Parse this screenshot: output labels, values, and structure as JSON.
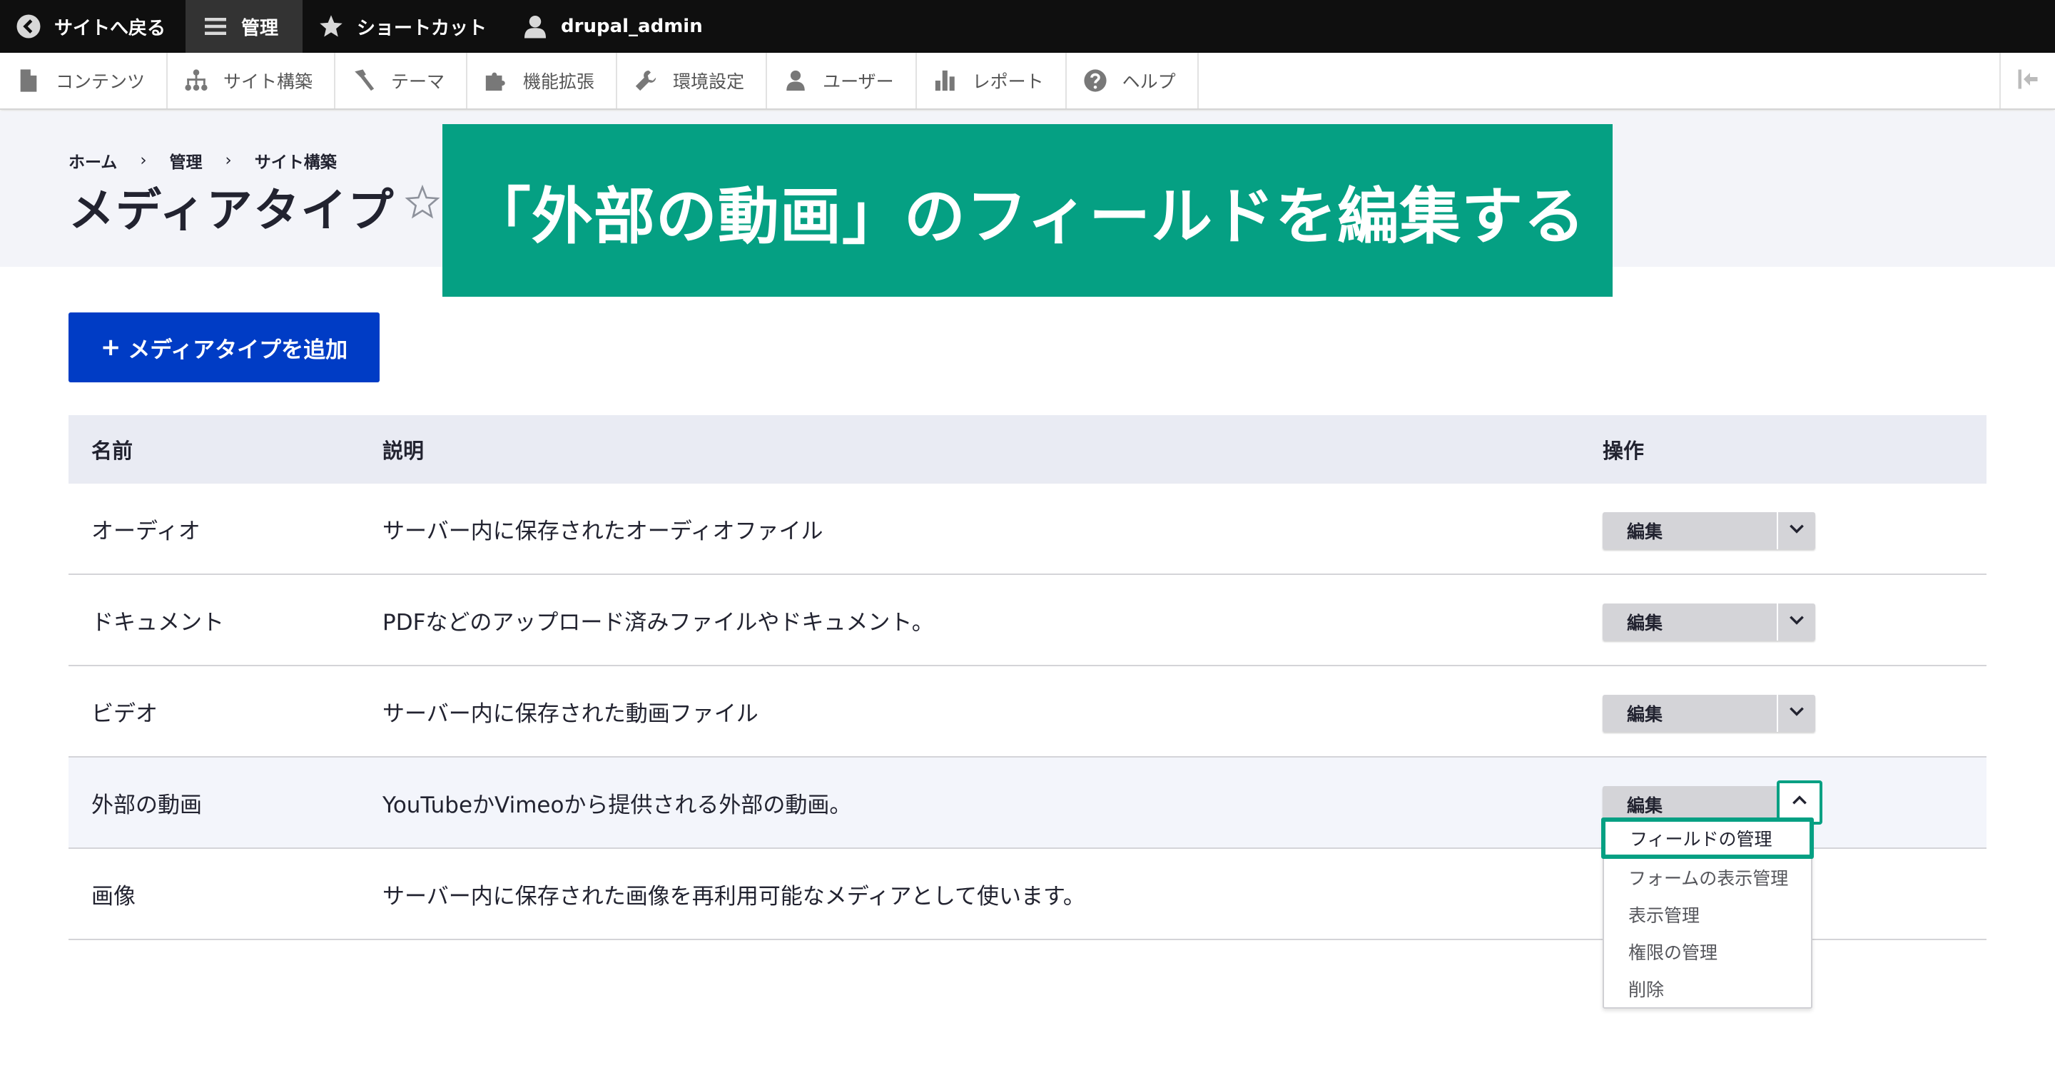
{
  "toolbar": {
    "back_label": "サイトへ戻る",
    "manage_label": "管理",
    "shortcuts_label": "ショートカット",
    "user_label": "drupal_admin"
  },
  "tray": {
    "items": [
      {
        "label": "コンテンツ",
        "icon": "file-icon"
      },
      {
        "label": "サイト構築",
        "icon": "sitemap-icon"
      },
      {
        "label": "テーマ",
        "icon": "brush-icon"
      },
      {
        "label": "機能拡張",
        "icon": "puzzle-icon"
      },
      {
        "label": "環境設定",
        "icon": "wrench-icon"
      },
      {
        "label": "ユーザー",
        "icon": "people-icon"
      },
      {
        "label": "レポート",
        "icon": "bar-chart-icon"
      },
      {
        "label": "ヘルプ",
        "icon": "help-icon"
      }
    ]
  },
  "breadcrumb": [
    "ホーム",
    "管理",
    "サイト構築"
  ],
  "breadcrumb_separator": "›",
  "page_title": "メディアタイプ",
  "banner_text": "「外部の動画」のフィールドを編集する",
  "add_button": {
    "plus": "+",
    "label": "メディアタイプを追加"
  },
  "table": {
    "headers": {
      "name": "名前",
      "description": "説明",
      "operations": "操作"
    },
    "rows": [
      {
        "name": "オーディオ",
        "description": "サーバー内に保存されたオーディオファイル",
        "op": "編集"
      },
      {
        "name": "ドキュメント",
        "description": "PDFなどのアップロード済みファイルやドキュメント。",
        "op": "編集"
      },
      {
        "name": "ビデオ",
        "description": "サーバー内に保存された動画ファイル",
        "op": "編集"
      },
      {
        "name": "外部の動画",
        "description": "YouTubeかVimeoから提供される外部の動画。",
        "op": "編集"
      },
      {
        "name": "画像",
        "description": "サーバー内に保存された画像を再利用可能なメディアとして使います。",
        "op": ""
      }
    ]
  },
  "dropdown": {
    "items": [
      "フィールドの管理",
      "フォームの表示管理",
      "表示管理",
      "権限の管理",
      "削除"
    ],
    "selected_index": 0
  },
  "colors": {
    "accent": "#05a083",
    "primary_button": "#003cc5",
    "toolbar_bg": "#0f0f0f"
  }
}
